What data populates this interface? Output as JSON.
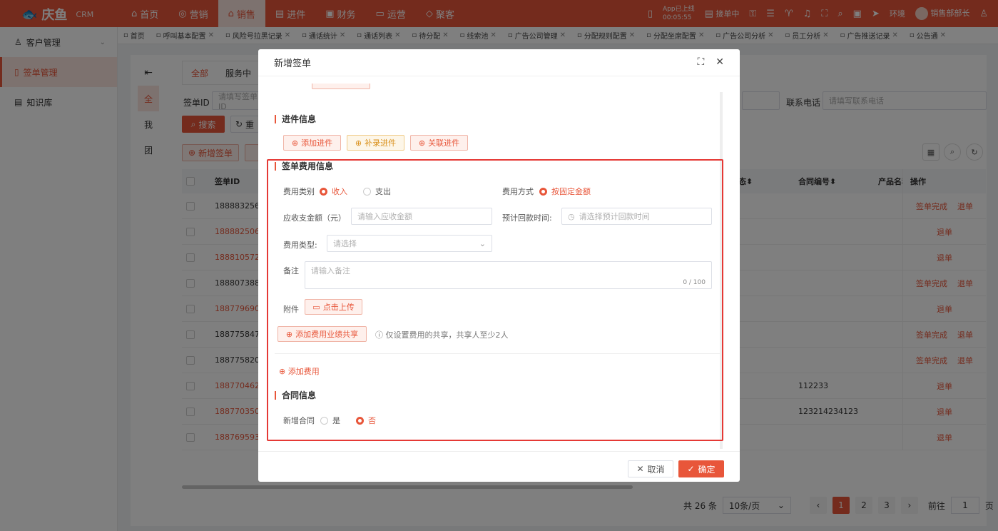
{
  "topbar": {
    "logo": "庆鱼",
    "logo_sub": "CRM",
    "nav": [
      {
        "icon": "⌂",
        "label": "首页",
        "active": false
      },
      {
        "icon": "◎",
        "label": "营销",
        "active": false
      },
      {
        "icon": "⌂",
        "label": "销售",
        "active": true
      },
      {
        "icon": "▤",
        "label": "进件",
        "active": false
      },
      {
        "icon": "▣",
        "label": "财务",
        "active": false
      },
      {
        "icon": "▭",
        "label": "运营",
        "active": false
      },
      {
        "icon": "◇",
        "label": "聚客",
        "active": false
      }
    ],
    "app_line1": "App已上线",
    "app_line2": "00:05:55",
    "status": "接单中",
    "env": "环境",
    "user": "销售部部长"
  },
  "sidebar": [
    {
      "label": "客户管理",
      "icon": "♙",
      "active": false,
      "expand": "⌄"
    },
    {
      "label": "签单管理",
      "icon": "▯",
      "active": true
    },
    {
      "label": "知识库",
      "icon": "▤",
      "active": false
    }
  ],
  "tabs": [
    "首页",
    "呼叫基本配置",
    "风险号拉黑记录",
    "通话统计",
    "通话列表",
    "待分配",
    "线索池",
    "广告公司管理",
    "分配规则配置",
    "分配坐席配置",
    "广告公司分析",
    "员工分析",
    "广告推送记录",
    "公告通"
  ],
  "bg": {
    "vtabs": [
      "全",
      "我",
      "团"
    ],
    "status_tabs": [
      "全部",
      "服务中"
    ],
    "id_label": "签单ID",
    "id_placeholder": "请填写签单ID",
    "phone_label": "联系电话",
    "phone_placeholder": "请填写联系电话",
    "search_btn": "搜索",
    "reset_btn": "重",
    "new_btn": "新增签单",
    "columns": {
      "id": "签单ID",
      "status": "态",
      "contract": "合同编号",
      "product": "产品名称",
      "ops": "操作"
    },
    "rows": [
      {
        "id": "18888325688",
        "red": false,
        "contract": "",
        "ops": [
          "签单完成",
          "退单"
        ]
      },
      {
        "id": "18888250654",
        "red": true,
        "contract": "",
        "ops": [
          "退单"
        ]
      },
      {
        "id": "18881057269",
        "red": true,
        "contract": "",
        "ops": [
          "退单"
        ]
      },
      {
        "id": "18880738893",
        "red": false,
        "contract": "",
        "ops": [
          "签单完成",
          "退单"
        ]
      },
      {
        "id": "18877969031",
        "red": true,
        "contract": "",
        "ops": [
          "退单"
        ]
      },
      {
        "id": "18877584712",
        "red": false,
        "contract": "",
        "ops": [
          "签单完成",
          "退单"
        ]
      },
      {
        "id": "18877582011",
        "red": false,
        "contract": "",
        "ops": [
          "签单完成",
          "退单"
        ]
      },
      {
        "id": "18877046271",
        "red": true,
        "contract": "112233",
        "ops": [
          "退单"
        ]
      },
      {
        "id": "18877035027",
        "red": true,
        "contract": "123214234123",
        "ops": [
          "退单"
        ]
      },
      {
        "id": "18876959332",
        "red": true,
        "contract": "",
        "ops": [
          "退单"
        ]
      }
    ],
    "pager": {
      "total": "共 26 条",
      "size": "10条/页",
      "pages": [
        "1",
        "2",
        "3"
      ],
      "goto": "前往",
      "goto_val": "1",
      "page_unit": "页"
    }
  },
  "modal": {
    "title": "新增签单",
    "section_jinjian": "进件信息",
    "btn_add_jinjian": "添加进件",
    "btn_bulu": "补录进件",
    "btn_guanlian": "关联进件",
    "section_fee": "签单费用信息",
    "fee_category_label": "费用类别",
    "fee_income": "收入",
    "fee_expense": "支出",
    "fee_method_label": "费用方式",
    "fee_method_value": "按固定金额",
    "amount_label": "应收支金额（元）",
    "amount_placeholder": "请输入应收金额",
    "expect_time_label": "预计回款时间:",
    "expect_time_placeholder": "请选择预计回款时间",
    "fee_type_label": "费用类型:",
    "fee_type_placeholder": "请选择",
    "remark_label": "备注",
    "remark_placeholder": "请输入备注",
    "remark_count": "0 / 100",
    "attach_label": "附件",
    "upload_btn": "点击上传",
    "share_btn": "添加费用业绩共享",
    "share_tip": "仅设置费用的共享，共享人至少2人",
    "add_fee": "添加费用",
    "section_contract": "合同信息",
    "new_contract_label": "新增合同",
    "yes": "是",
    "no": "否",
    "cancel": "取消",
    "confirm": "确定"
  }
}
